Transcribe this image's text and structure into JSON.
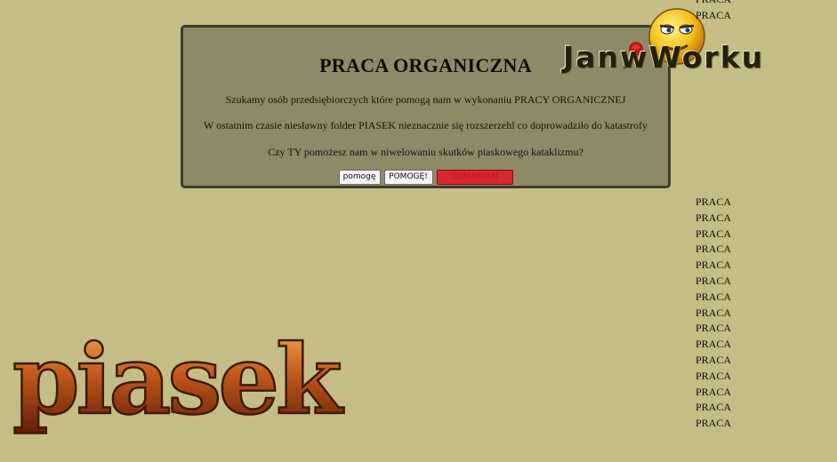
{
  "panel": {
    "title": "PRACA ORGANICZNA",
    "line1": "Szukamy osób przedsiębiorczych które pomogą nam w wykonaniu PRACY ORGANICZNEJ",
    "line2": "W ostatnim czasie niesławny folder PIASEK nieznacznie się rozszerzehl co doprowadziło do katastrofy",
    "line3": "Czy TY pomożesz nam w niwelowaniu skutków piaskowego kataklizmu?",
    "buttons": [
      "pomogę",
      "POMOGĘ!",
      "ODMAWIAM"
    ]
  },
  "logo": {
    "text": "JanwWorku"
  },
  "side_list_top": [
    "PRACA",
    "PRACA"
  ],
  "side_list": [
    "PRACA",
    "PRACA",
    "PRACA",
    "PRACA",
    "PRACA",
    "PRACA",
    "PRACA",
    "PRACA",
    "PRACA",
    "PRACA",
    "PRACA",
    "PRACA",
    "PRACA",
    "PRACA",
    "PRACA"
  ],
  "banner": {
    "text": "piasek"
  },
  "colors": {
    "background": "#c5bd86",
    "panel": "#8f8a65",
    "panel_border": "#3c3c2c",
    "refuse_button": "#d9282d"
  }
}
